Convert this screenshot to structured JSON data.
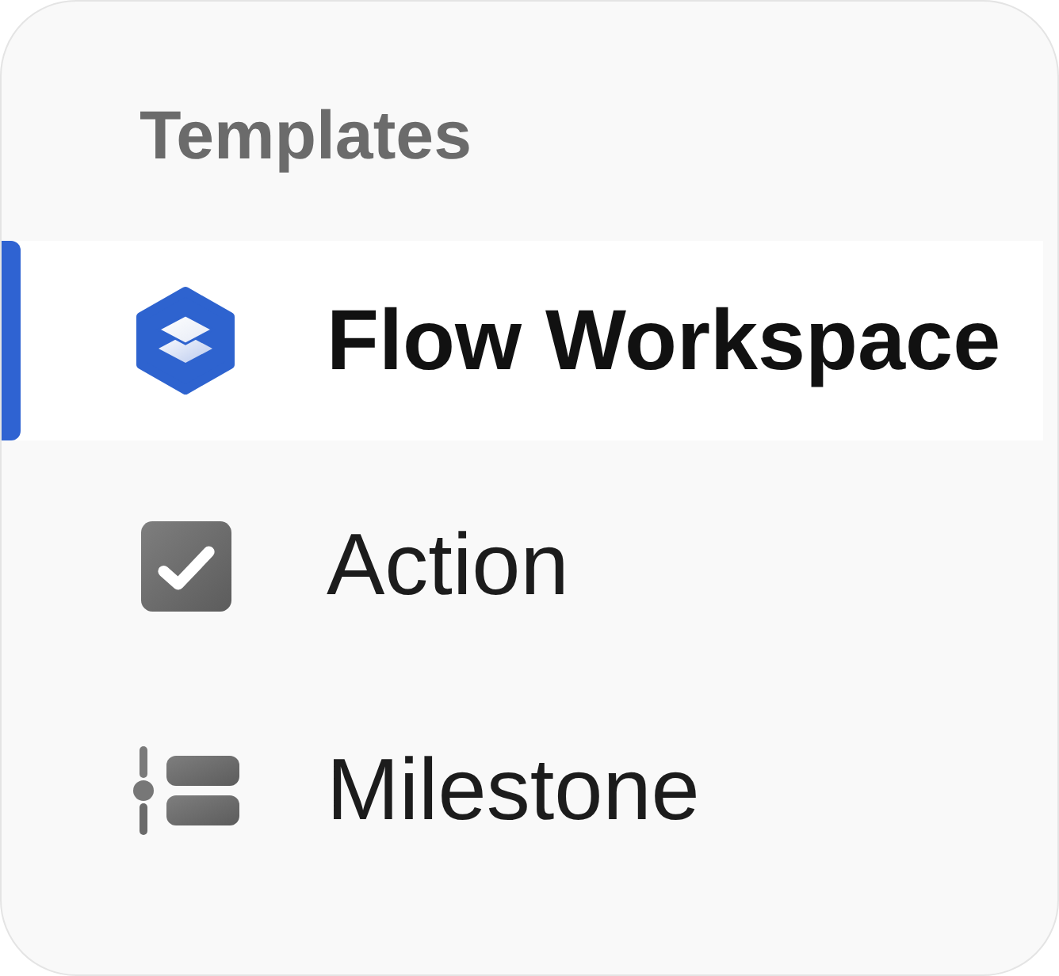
{
  "heading": "Templates",
  "items": [
    {
      "kind": "workspace",
      "label": "Flow Workspace",
      "selected": true
    },
    {
      "kind": "action",
      "label": "Action",
      "selected": false
    },
    {
      "kind": "milestone",
      "label": "Milestone",
      "selected": false
    }
  ]
}
